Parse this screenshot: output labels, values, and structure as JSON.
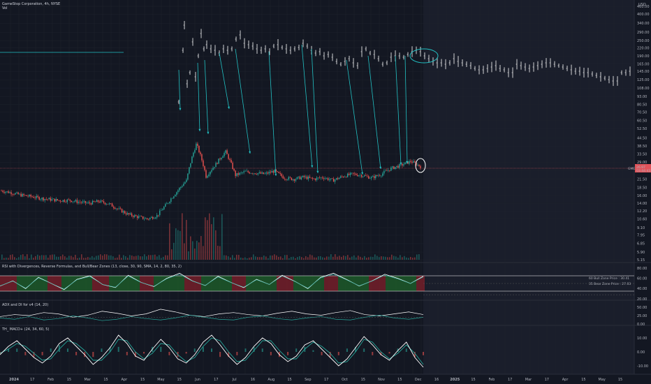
{
  "header": {
    "symbol_line": "GameStop Corporation, 4h, NYSE",
    "vol_label": "Vol",
    "currency": "USD"
  },
  "colors": {
    "background": "#131722",
    "future_shade": "#1a1e2b",
    "up": "#26a69a",
    "down": "#ef5350",
    "annotation": "#22c1c3",
    "price_line": "#e0535a",
    "white": "#ffffff"
  },
  "price_pane": {
    "last_price_label": "GME",
    "last_price": "26.97",
    "last_price_sub": "03:44:43"
  },
  "rsi_pane": {
    "title": "RSI with Divergences, Reverse Formulas, and Bull/Bear Zones (13, close, 30, 90, SMA, 14, 2, 80, 35, 2)",
    "bull_zone": "60 Bull Zone Price : 30.41",
    "bear_zone": "35 Bear Zone Price : 27.03",
    "axis": [
      "80.00",
      "60.00",
      "40.00",
      "20.00"
    ]
  },
  "adx_pane": {
    "title": "ADX and DI for v4 (14, 20)",
    "axis": [
      "50.00",
      "25.00",
      "0.00"
    ]
  },
  "macd_pane": {
    "title": "TH_ MACD+ (24, 34, 60, 5)",
    "axis": [
      "10.00",
      "0.00",
      "-10.00"
    ]
  },
  "chart_data": [
    {
      "type": "line",
      "title": "GameStop Corporation, 4h, NYSE",
      "xlabel": "",
      "ylabel": "",
      "scale": "log",
      "y_ticks": [
        "460.00",
        "400.00",
        "340.00",
        "290.00",
        "250.00",
        "220.00",
        "190.00",
        "165.00",
        "145.00",
        "125.00",
        "108.00",
        "93.00",
        "80.50",
        "70.50",
        "60.50",
        "52.50",
        "44.50",
        "38.50",
        "33.50",
        "29.00",
        "25.00",
        "21.50",
        "18.50",
        "16.00",
        "14.00",
        "12.20",
        "10.60",
        "9.10",
        "7.95",
        "6.85",
        "5.90",
        "5.15"
      ],
      "x_ticks": [
        "2024",
        "17",
        "Feb",
        "15",
        "Mar",
        "15",
        "Apr",
        "15",
        "May",
        "15",
        "Jun",
        "17",
        "Jul",
        "16",
        "Aug",
        "15",
        "Sep",
        "17",
        "Oct",
        "15",
        "Nov",
        "15",
        "Dec",
        "16",
        "2025",
        "15",
        "Feb",
        "17",
        "Mar",
        "17",
        "Apr",
        "15",
        "May",
        "15"
      ],
      "series": [
        {
          "values": [
            17.5,
            16.9,
            16.2,
            15.8,
            15.3,
            15.0,
            14.7,
            14.8,
            14.3,
            14.0,
            14.5,
            13.9,
            12.6,
            11.5,
            11.0,
            10.6,
            11.3,
            13.9,
            17.2,
            21.0,
            40.0,
            22.5,
            28.0,
            35.0,
            23.0,
            24.5,
            24.0,
            23.5,
            24.8,
            22.0,
            21.5,
            22.3,
            21.5,
            22.2,
            21.0,
            22.5,
            23.5,
            23.0,
            22.0,
            23.5,
            26.0,
            27.5,
            29.5,
            26.97
          ]
        }
      ],
      "annotations": {
        "horizontal_price": 26.97,
        "arrows_count": 12,
        "circles": 2
      }
    },
    {
      "type": "line",
      "title": "RSI with Divergences, Reverse Formulas, and Bull/Bear Zones (13, close, 30, 90, SMA, 14, 2, 80, 35, 2)",
      "ylim": [
        20,
        80
      ],
      "series": [
        {
          "values": [
            45,
            55,
            40,
            62,
            50,
            38,
            58,
            65,
            48,
            42,
            66,
            52,
            44,
            60,
            70,
            55,
            46,
            64,
            52,
            42,
            58,
            48,
            66,
            54,
            40,
            62,
            70,
            58,
            45,
            55,
            68,
            60,
            50,
            64
          ]
        }
      ]
    },
    {
      "type": "line",
      "title": "ADX and DI for v4 (14, 20)",
      "ylim": [
        0,
        50
      ],
      "series": [
        {
          "values": [
            22,
            28,
            25,
            34,
            30,
            20,
            26,
            38,
            32,
            24,
            30,
            44,
            36,
            26,
            22,
            30,
            34,
            28,
            24,
            32,
            38,
            30,
            26,
            34,
            40,
            28,
            24,
            30,
            36,
            28
          ]
        },
        {
          "values": [
            18,
            14,
            22,
            12,
            16,
            24,
            18,
            10,
            14,
            22,
            16,
            12,
            18,
            26,
            20,
            14,
            12,
            20,
            24,
            16,
            12,
            18,
            22,
            14,
            12,
            20,
            26,
            18,
            14,
            20
          ]
        }
      ]
    },
    {
      "type": "line",
      "title": "TH_ MACD+ (24, 34, 60, 5)",
      "ylim": [
        -12,
        14
      ],
      "series": [
        {
          "values": [
            -2,
            4,
            8,
            2,
            -4,
            -8,
            -3,
            6,
            10,
            4,
            -2,
            -9,
            -4,
            3,
            12,
            6,
            -3,
            -6,
            2,
            9,
            3,
            -5,
            -8,
            -2,
            7,
            12,
            5,
            -3,
            -9,
            -4,
            4,
            10,
            6,
            -2,
            -7,
            -3,
            5,
            8,
            2,
            -4,
            -10,
            -5,
            3,
            11,
            5,
            -2,
            -6,
            1,
            7,
            -4,
            -11
          ]
        },
        {
          "values": [
            -1,
            2,
            6,
            4,
            -1,
            -6,
            -5,
            2,
            8,
            6,
            1,
            -6,
            -6,
            0,
            9,
            8,
            0,
            -5,
            -1,
            6,
            5,
            -2,
            -7,
            -4,
            4,
            10,
            8,
            0,
            -7,
            -6,
            1,
            8,
            8,
            1,
            -5,
            -5,
            2,
            7,
            4,
            -1,
            -8,
            -7,
            0,
            9,
            7,
            0,
            -5,
            -1,
            5,
            -1,
            -9
          ]
        }
      ]
    }
  ]
}
